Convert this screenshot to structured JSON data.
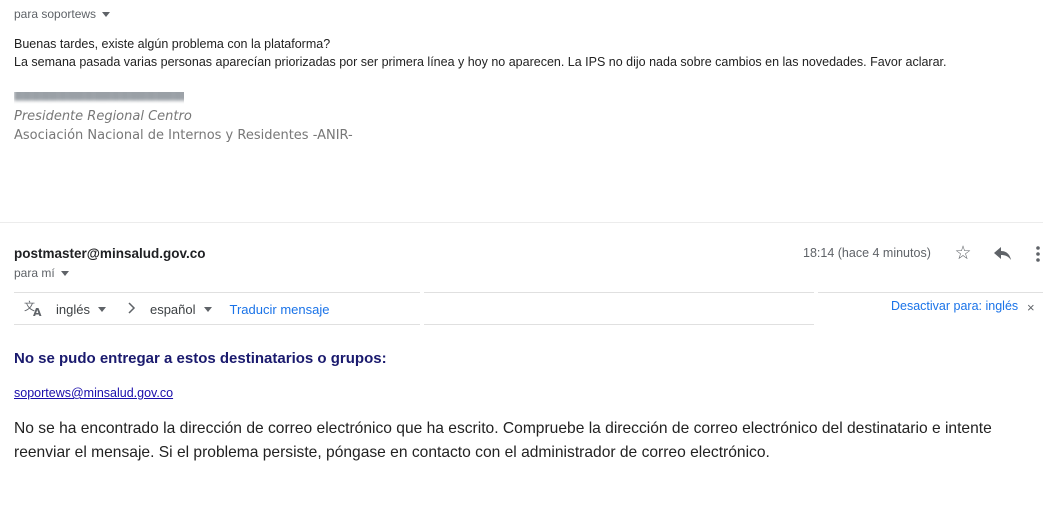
{
  "first_message": {
    "to_line": "para soportews",
    "body_lines": [
      "Buenas tardes, existe algún problema con la plataforma?",
      "La semana pasada varias personas aparecían priorizadas por ser primera línea y hoy no aparecen. La IPS no dijo nada sobre cambios en las novedades. Favor aclarar."
    ],
    "signature": {
      "role": "Presidente Regional Centro",
      "organization": "Asociación Nacional de Internos y Residentes -ANIR-"
    }
  },
  "second_message": {
    "sender": "postmaster@minsalud.gov.co",
    "to_line": "para mí",
    "timestamp": "18:14 (hace 4 minutos)",
    "icons": {
      "star": "star-icon",
      "reply": "reply-icon",
      "more": "more-vert-icon"
    }
  },
  "translate_bar": {
    "source_lang": "inglés",
    "target_lang": "español",
    "translate_link": "Traducir mensaje",
    "disable_link": "Desactivar para: inglés",
    "close_symbol": "×"
  },
  "bounce": {
    "title": "No se pudo entregar a estos destinatarios o grupos:",
    "address": "soportews@minsalud.gov.co",
    "message": "No se ha encontrado la dirección de correo electrónico que ha escrito. Compruebe la dirección de correo electrónico del destinatario e intente reenviar el mensaje. Si el problema persiste, póngase en contacto con el administrador de correo electrónico."
  },
  "colors": {
    "link": "#1a73e8",
    "bounce_title": "#1a1a6e",
    "secondary_text": "#5f6368"
  }
}
